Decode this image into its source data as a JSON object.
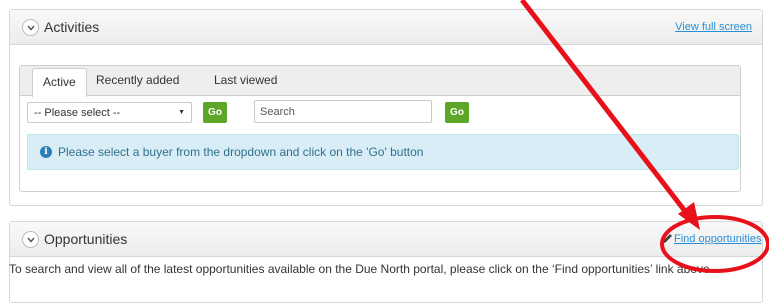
{
  "activities": {
    "title": "Activities",
    "view_full_screen": "View full screen",
    "tabs": [
      {
        "label": "Active",
        "active": true
      },
      {
        "label": "Recently added",
        "active": false
      },
      {
        "label": "Last viewed",
        "active": false
      }
    ],
    "buyer_select_value": "-- Please select --",
    "go_label": "Go",
    "search_placeholder": "Search",
    "info_message": "Please select a buyer from the dropdown and click on the 'Go' button"
  },
  "opportunities": {
    "title": "Opportunities",
    "find_link": "Find opportunities",
    "description": "To search and view all of the latest opportunities available on the Due North portal, please click on the ‘Find opportunities’ link above"
  },
  "colors": {
    "link": "#2a8fd6",
    "go_button": "#5ea628",
    "alert_bg": "#d9edf7",
    "alert_text": "#31708f",
    "annotation": "#e8101a"
  },
  "icons": {
    "collapse": "chevron-down-icon",
    "info": "info-icon",
    "edit": "pencil-icon"
  }
}
